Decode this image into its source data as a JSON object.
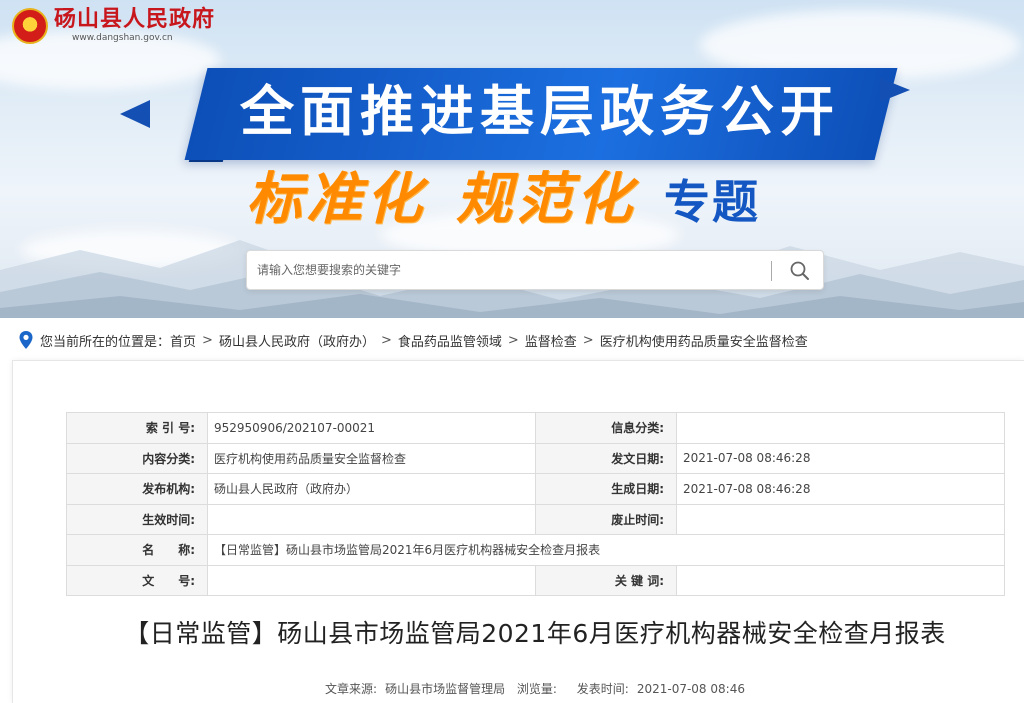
{
  "site": {
    "name": "砀山县人民政府",
    "url": "www.dangshan.gov.cn",
    "emblem_icon": "national-emblem-icon"
  },
  "banner": {
    "headline": "全面推进基层政务公开",
    "slogan_part1": "标准化",
    "slogan_part2": "规范化",
    "slogan_part3": "专题",
    "colors": {
      "ribbon": "#1c6fe0",
      "slogan_orange": "#ff8a00",
      "slogan_blue": "#1457c2"
    }
  },
  "search": {
    "placeholder": "请输入您想要搜索的关键字",
    "icon": "search-icon"
  },
  "breadcrumb": {
    "prefix": "您当前所在的位置是：",
    "items": [
      "首页",
      "砀山县人民政府（政府办）",
      "食品药品监管领域",
      "监督检查",
      "医疗机构使用药品质量安全监督检查"
    ],
    "separator": ">"
  },
  "meta": {
    "index_label": "索 引 号:",
    "index_value": "952950906/202107-00021",
    "category_label": "信息分类:",
    "category_value": "",
    "content_label": "内容分类:",
    "content_value": "医疗机构使用药品质量安全监督检查",
    "issue_date_label": "发文日期:",
    "issue_date_value": "2021-07-08 08:46:28",
    "publisher_label": "发布机构:",
    "publisher_value": "砀山县人民政府（政府办）",
    "generated_label": "生成日期:",
    "generated_value": "2021-07-08 08:46:28",
    "effective_label": "生效时间:",
    "effective_value": "",
    "expiry_label": "废止时间:",
    "expiry_value": "",
    "name_label": "名　　称:",
    "name_value": "【日常监管】砀山县市场监管局2021年6月医疗机构器械安全检查月报表",
    "doc_no_label": "文　　号:",
    "doc_no_value": "",
    "keywords_label": "关 键 词:",
    "keywords_value": ""
  },
  "article": {
    "title": "【日常监管】砀山县市场监管局2021年6月医疗机构器械安全检查月报表",
    "source_label": "文章来源:",
    "source_value": "砀山县市场监督管理局",
    "views_label": "浏览量:",
    "views_value": "",
    "published_label": "发表时间:",
    "published_value": "2021-07-08 08:46"
  }
}
